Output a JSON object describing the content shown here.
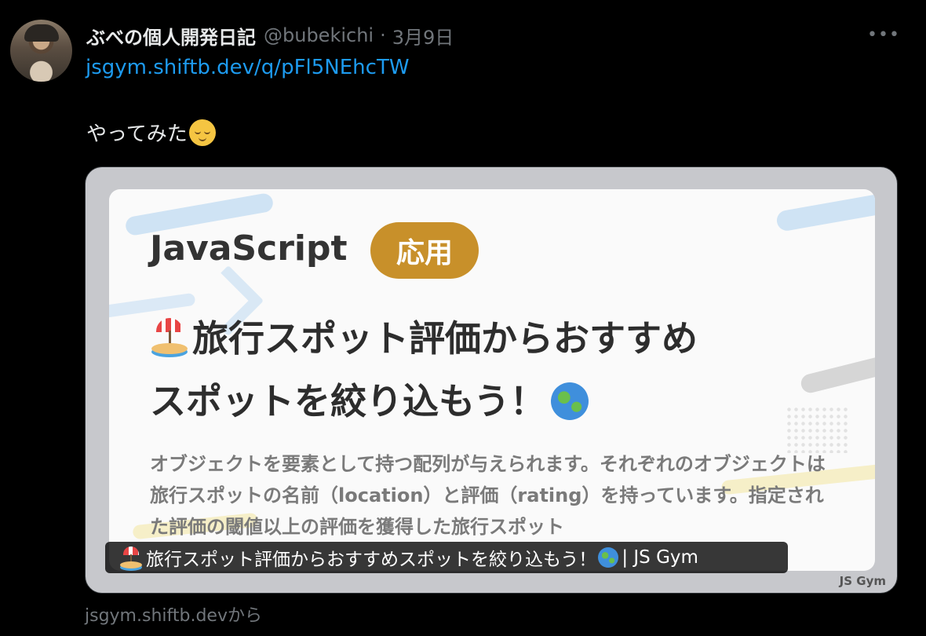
{
  "tweet": {
    "display_name": "ぶべの個人開発日記",
    "handle": "@bubekichi",
    "separator": "·",
    "date": "3月9日",
    "more_icon": "more-horizontal-icon",
    "link": "jsgym.shiftb.dev/q/pFl5NEhcTW",
    "text": "やってみた",
    "text_emoji": "relieved-face-icon"
  },
  "card": {
    "language": "JavaScript",
    "level_badge": "応用",
    "headline_line1": "旅行スポット評価からおすすめ",
    "headline_line2": "スポットを絞り込もう！",
    "description": "オブジェクトを要素として持つ配列が与えられます。それぞれのオブジェクトは旅行スポットの名前（location）と評価（rating）を持っています。指定された評価の閾値以上の評価を獲得した旅行スポット",
    "brand_mark": "JS Gym",
    "overlay_title": "旅行スポット評価からおすすめスポットを絞り込もう！",
    "overlay_suffix": "| JS Gym",
    "source": "jsgym.shiftb.devから",
    "colors": {
      "badge": "#c8902a",
      "link": "#1d9bf0",
      "muted": "#71767b"
    }
  }
}
